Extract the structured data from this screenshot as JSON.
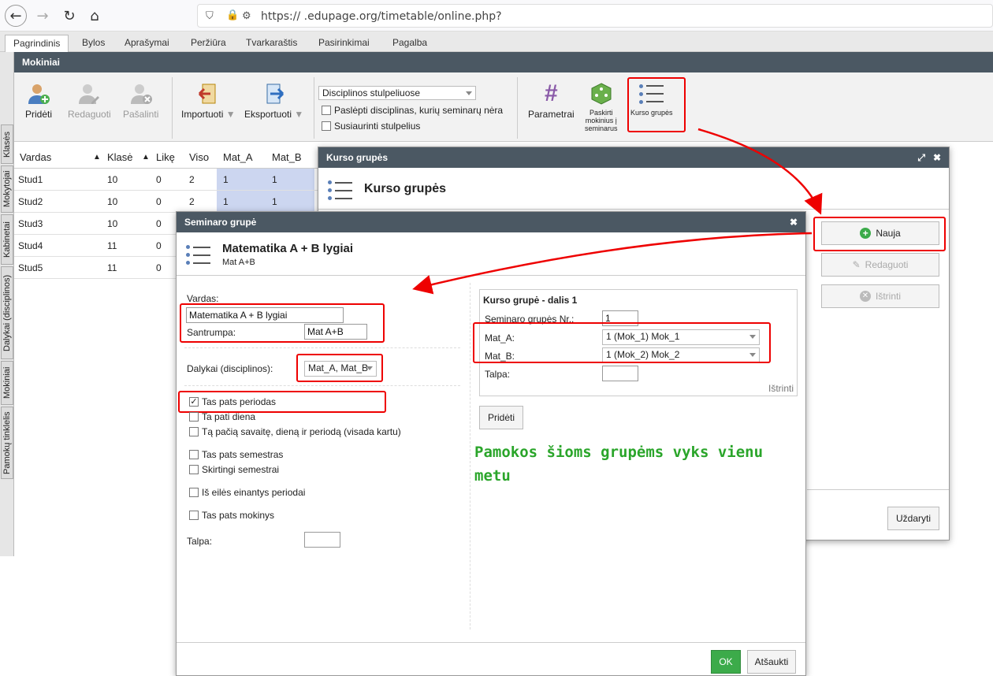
{
  "browser": {
    "url": "https://      .edupage.org/timetable/online.php?"
  },
  "menu": [
    "Pagrindinis",
    "Bylos",
    "Aprašymai",
    "Peržiūra",
    "Tvarkaraštis",
    "Pasirinkimai",
    "Pagalba"
  ],
  "sidebar_tabs": [
    "Klasės",
    "Mokytojai",
    "Kabinetai",
    "Dalykai (disciplinos)",
    "Mokiniai",
    "Pamokų tinklelis"
  ],
  "panel_title": "Mokiniai",
  "toolbar": {
    "add": "Pridėti",
    "edit": "Redaguoti",
    "remove": "Pašalinti",
    "import": "Importuoti",
    "export": "Eksportuoti",
    "select_value": "Disciplinos stulpeliuose",
    "hide_label": "Paslėpti disciplinas, kurių seminarų nėra",
    "narrow_label": "Susiaurinti stulpelius",
    "params": "Parametrai",
    "assign_l1": "Paskirti",
    "assign_l2": "mokinius į",
    "assign_l3": "seminarus",
    "groups": "Kurso grupės"
  },
  "grid": {
    "headers": [
      "Vardas",
      "▲",
      "Klasė",
      "▲",
      "Likę",
      "Viso",
      "Mat_A",
      "Mat_B"
    ],
    "rows": [
      [
        "Stud1",
        "10",
        "0",
        "2",
        "1",
        "1"
      ],
      [
        "Stud2",
        "10",
        "0",
        "2",
        "1",
        "1"
      ],
      [
        "Stud3",
        "10",
        "0",
        "",
        "",
        ""
      ],
      [
        "Stud4",
        "11",
        "0",
        "",
        "",
        ""
      ],
      [
        "Stud5",
        "11",
        "0",
        "",
        "",
        ""
      ]
    ]
  },
  "kurso": {
    "title": "Kurso grupės",
    "heading": "Kurso grupės",
    "new": "Nauja",
    "edit": "Redaguoti",
    "delete": "Ištrinti",
    "close": "Uždaryti"
  },
  "seminar": {
    "title": "Seminaro grupė",
    "heading": "Matematika A + B lygiai",
    "sub": "Mat A+B",
    "name_label": "Vardas:",
    "name_value": "Matematika A + B lygiai",
    "abbr_label": "Santrumpa:",
    "abbr_value": "Mat A+B",
    "subjects_label": "Dalykai (disciplinos):",
    "subjects_value": "Mat_A, Mat_B",
    "options": [
      "Tas pats periodas",
      "Ta pati diena",
      "Tą pačią savaitę, dieną ir periodą (visada kartu)",
      "Tas pats semestras",
      "Skirtingi semestrai",
      "Iš eilės einantys periodai",
      "Tas pats mokinys"
    ],
    "capacity_label": "Talpa:",
    "part_title": "Kurso grupė - dalis 1",
    "group_no_label": "Seminaro grupės Nr.:",
    "group_no_value": "1",
    "mat_a_label": "Mat_A:",
    "mat_a_value": "1 (Mok_1) Mok_1",
    "mat_b_label": "Mat_B:",
    "mat_b_value": "1 (Mok_2) Mok_2",
    "part_capacity_label": "Talpa:",
    "part_delete": "Ištrinti",
    "add": "Pridėti",
    "note_l1": "Pamokos šioms grupėms vyks vienu",
    "note_l2": "metu",
    "ok": "OK",
    "cancel": "Atšaukti"
  },
  "colors": {
    "header": "#4b5863",
    "accent_red": "#e00000",
    "note_green": "#2aa52a",
    "ok_green": "#3cab4a"
  }
}
